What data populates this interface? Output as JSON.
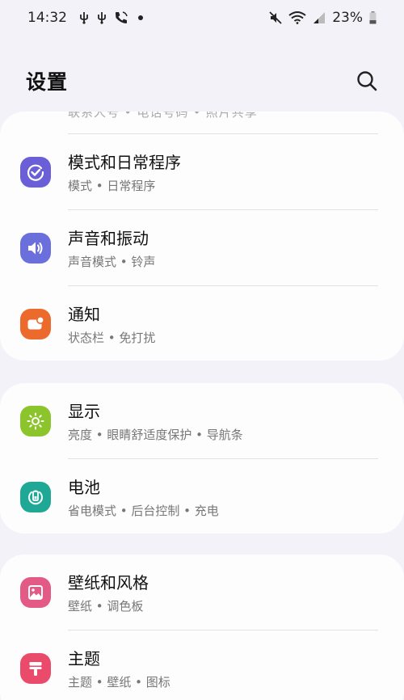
{
  "status_bar": {
    "time": "14:32",
    "battery": "23%"
  },
  "header": {
    "title": "设置"
  },
  "ghost_item": {
    "subtitle": "联系人号 • 电话号码 • 照片共享"
  },
  "groups": [
    {
      "items": [
        {
          "title": "模式和日常程序",
          "subtitle": "模式 • 日常程序",
          "icon": "check-circle-icon",
          "color": "#6a5fd6"
        },
        {
          "title": "声音和振动",
          "subtitle": "声音模式 • 铃声",
          "icon": "speaker-icon",
          "color": "#6b6fdc"
        },
        {
          "title": "通知",
          "subtitle": "状态栏 • 免打扰",
          "icon": "notification-icon",
          "color": "#ec6a2c"
        }
      ]
    },
    {
      "items": [
        {
          "title": "显示",
          "subtitle": "亮度 • 眼睛舒适度保护 • 导航条",
          "icon": "sun-icon",
          "color": "#8cc42c"
        },
        {
          "title": "电池",
          "subtitle": "省电模式 • 后台控制 • 充电",
          "icon": "battery-icon",
          "color": "#1fa896"
        }
      ]
    },
    {
      "items": [
        {
          "title": "壁纸和风格",
          "subtitle": "壁纸 • 调色板",
          "icon": "wallpaper-icon",
          "color": "#e25a85"
        },
        {
          "title": "主题",
          "subtitle": "主题 • 壁纸 • 图标",
          "icon": "theme-icon",
          "color": "#ea4b6b"
        }
      ]
    }
  ]
}
